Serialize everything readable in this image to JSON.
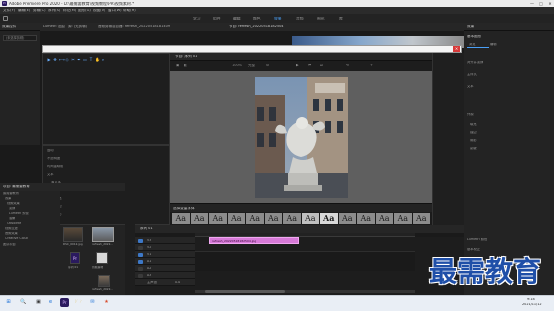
{
  "window": {
    "title": "Adobe Premiere Pro 2020 - D:\\最需要教育\\视频教程\\PR\\视频素材.*",
    "minimize": "—",
    "maximize": "□",
    "close": "✕"
  },
  "menubar": [
    "文件(F)",
    "编辑(E)",
    "剪辑(C)",
    "序列(S)",
    "标记(M)",
    "图形(G)",
    "视图(V)",
    "窗口(W)",
    "帮助(H)"
  ],
  "workspaces": [
    {
      "label": "学习",
      "active": false
    },
    {
      "label": "组件",
      "active": false
    },
    {
      "label": "编辑",
      "active": false
    },
    {
      "label": "颜色",
      "active": false
    },
    {
      "label": "效果",
      "active": true
    },
    {
      "label": "音频",
      "active": false
    },
    {
      "label": "图形",
      "active": false
    },
    {
      "label": "库",
      "active": false
    }
  ],
  "left_top": {
    "tab": "效果控件",
    "dropdown": "(未选择剪辑)"
  },
  "top_tabs": [
    "Lumetri 范围",
    "源: (无剪辑)",
    "音频剪辑混合器: refresh_20220518181409"
  ],
  "program_tab": "节目: refresh_20220518182504",
  "dialog": {
    "close": "×"
  },
  "tools": [
    "▶",
    "✥",
    "⟷",
    "◇",
    "✂",
    "✒",
    "▭",
    "T",
    "✋",
    "⌕"
  ],
  "monitor": {
    "title": "节目: 序列 01",
    "toolbar": [
      "▣",
      "◧",
      "100%",
      "完整",
      "⚙",
      "▶",
      "⏮",
      "⏭",
      "⟲",
      "+"
    ]
  },
  "font_browser": {
    "title": "选择变量字体",
    "samples": [
      "Aa",
      "Aa",
      "Aa",
      "Aa",
      "Aa",
      "Aa",
      "Aa",
      "Aa",
      "Aa",
      "Aa",
      "Aa",
      "Aa",
      "Aa",
      "Aa"
    ]
  },
  "fx_panel": {
    "rows": [
      "运动",
      "不透明度",
      "时间重映射",
      "文本",
      "源文本",
      "外观",
      "填充",
      "描边",
      "阴影"
    ]
  },
  "project": {
    "title": "项目: 最需要教育",
    "tree": [
      "最需要教育",
      "效果",
      "视频效果",
      "变换",
      "Lumetri 预设",
      "溶解",
      "Obsolete",
      "视频过渡",
      "音频效果",
      "Creative Cloud",
      "团队项目"
    ],
    "thumbs": [
      {
        "caption": "DSC_0012.jpg"
      },
      {
        "caption": "refresh_2022..."
      },
      {
        "caption": "序列 01"
      },
      {
        "caption": "音频素材"
      },
      {
        "caption": "refresh_2022..."
      }
    ]
  },
  "timeline": {
    "tab": "序列 01",
    "tracks": [
      {
        "name": "V3"
      },
      {
        "name": "V2"
      },
      {
        "name": "V1"
      },
      {
        "name": "A1"
      },
      {
        "name": "A2"
      },
      {
        "name": "A3"
      },
      {
        "name": "主声道"
      }
    ],
    "clip": "refresh_20220518182504.jpg",
    "master_value": "0.0"
  },
  "right_panel": {
    "title": "效果",
    "rows": [
      "基本图形",
      "浏览",
      "编辑",
      "对齐并变换",
      "主样式",
      "文本",
      "外观",
      "填充",
      "描边",
      "阴影",
      "蒙版"
    ],
    "lumetri": "Lumetri 颜色",
    "basic": "基本校正"
  },
  "taskbar": {
    "time": "9:18",
    "date": "2021/11/12",
    "icons": [
      "⊞",
      "🔍",
      "▣",
      "e",
      "Pr",
      "🗁",
      "✉",
      "★"
    ]
  },
  "watermark": "最需教育"
}
